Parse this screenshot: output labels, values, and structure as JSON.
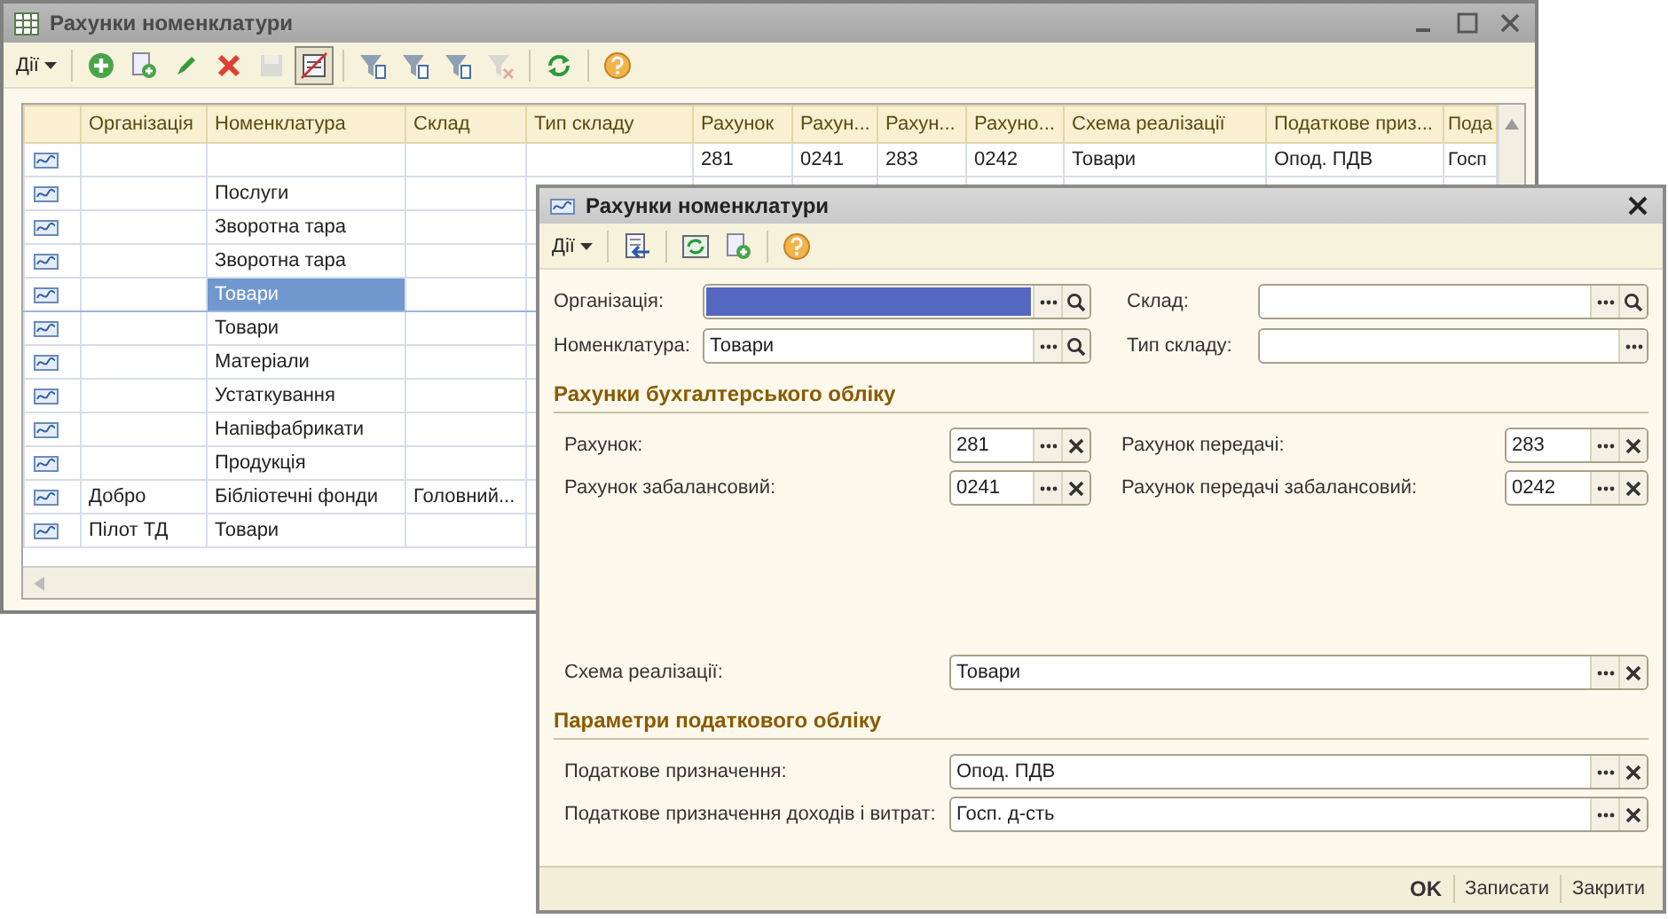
{
  "list_window": {
    "title": "Рахунки номенклатури",
    "toolbar": {
      "menu": "Дії",
      "buttons": [
        {
          "disabled": false,
          "pressed": false
        },
        {
          "disabled": false,
          "pressed": false
        },
        {
          "disabled": false,
          "pressed": false
        },
        {
          "disabled": false,
          "pressed": false
        },
        {
          "disabled": true,
          "pressed": false
        },
        {
          "disabled": false,
          "pressed": true
        },
        {
          "disabled": false,
          "pressed": false
        },
        {
          "disabled": false,
          "pressed": false
        },
        {
          "disabled": false,
          "pressed": false
        },
        {
          "disabled": true,
          "pressed": false
        },
        {
          "disabled": false,
          "pressed": false
        },
        {
          "disabled": false,
          "pressed": false
        }
      ]
    },
    "table": {
      "columns": [
        "Організація",
        "Номенклатура",
        "Склад",
        "Тип складу",
        "Рахунок",
        "Рахун...",
        "Рахун...",
        "Рахуно...",
        "Схема реалізації",
        "Податкове приз...",
        "Пода"
      ],
      "rows": [
        {
          "selected": false,
          "account": "281",
          "account_2": "0241",
          "account_3": "283",
          "account_4": "0242",
          "scheme": "Товари",
          "tax_purpose": "Опод. ПДВ",
          "column_11": "Госп"
        },
        {
          "selected": false,
          "nomenclature": "Послуги"
        },
        {
          "selected": false,
          "nomenclature": "Зворотна тара"
        },
        {
          "selected": false,
          "nomenclature": "Зворотна тара"
        },
        {
          "selected": true,
          "nomenclature": "Товари"
        },
        {
          "selected": false,
          "nomenclature": "Товари"
        },
        {
          "selected": false,
          "nomenclature": "Матеріали"
        },
        {
          "selected": false,
          "nomenclature": "Устаткування"
        },
        {
          "selected": false,
          "nomenclature": "Напівфабрикати"
        },
        {
          "selected": false,
          "nomenclature": "Продукція"
        },
        {
          "selected": false,
          "organization": "Добро",
          "nomenclature": "Бібліотечні фонди",
          "warehouse": "Головний..."
        },
        {
          "selected": false,
          "organization": "Пілот ТД",
          "nomenclature": "Товари"
        }
      ]
    }
  },
  "dialog": {
    "title": "Рахунки номенклатури",
    "toolbar": {
      "menu": "Дії"
    },
    "top_fields": [
      {
        "label": "Організація:",
        "kind": "lookup",
        "focused": true
      },
      {
        "label": "Склад:",
        "kind": "lookup",
        "focused": false
      },
      {
        "label": "Номенклатура:",
        "value": "Товари",
        "kind": "lookup",
        "focused": false
      },
      {
        "label": "Тип складу:",
        "kind": "choose",
        "focused": false
      }
    ],
    "accounting": {
      "heading": "Рахунки бухгалтерського обліку",
      "fields": [
        {
          "label": "Рахунок:",
          "value": "281"
        },
        {
          "label": "Рахунок передачі:",
          "value": "283"
        },
        {
          "label": "Рахунок забалансовий:",
          "value": "0241"
        },
        {
          "label": "Рахунок передачі забалансовий:",
          "value": "0242"
        }
      ]
    },
    "scheme": {
      "label": "Схема реалізації:",
      "value": "Товари"
    },
    "tax": {
      "heading": "Параметри податкового обліку",
      "fields": [
        {
          "label": "Податкове призначення:",
          "value": "Опод. ПДВ"
        },
        {
          "label": "Податкове призначення доходів і витрат:",
          "value": "Госп. д-сть"
        }
      ]
    },
    "footer_buttons": [
      "OK",
      "Записати",
      "Закрити"
    ]
  }
}
